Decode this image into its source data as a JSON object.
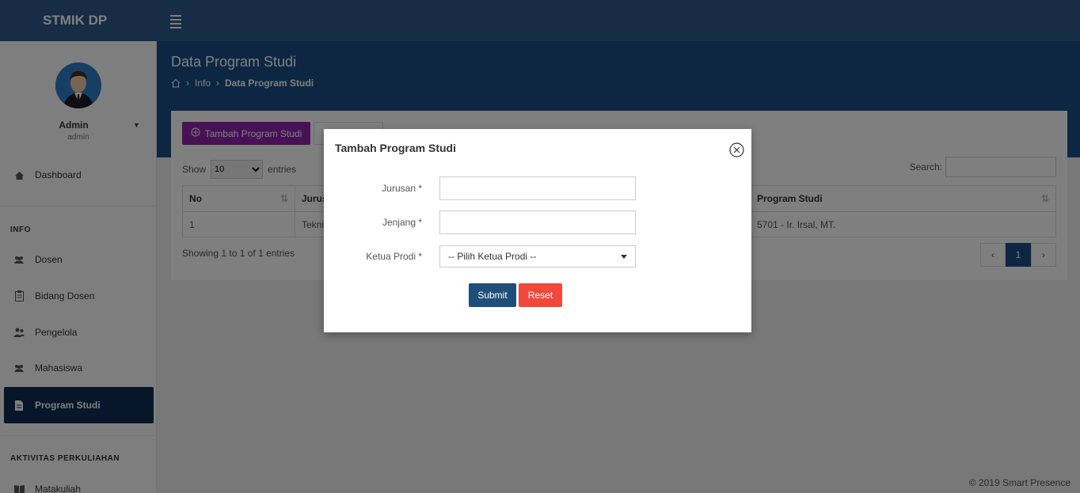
{
  "app": {
    "brand": "STMIK DP"
  },
  "user": {
    "name": "Admin",
    "role": "admin"
  },
  "sidebar": {
    "items": [
      {
        "label": "Dashboard",
        "icon": "home-icon"
      },
      {
        "label": "Dosen",
        "icon": "users-icon"
      },
      {
        "label": "Bidang Dosen",
        "icon": "clipboard-icon"
      },
      {
        "label": "Pengelola",
        "icon": "user-group-icon"
      },
      {
        "label": "Mahasiswa",
        "icon": "users-icon"
      },
      {
        "label": "Program Studi",
        "icon": "file-icon",
        "active": true
      },
      {
        "label": "Matakuliah",
        "icon": "book-icon"
      }
    ],
    "sections": {
      "info": "INFO",
      "aktivitas": "AKTIVITAS PERKULIAHAN"
    }
  },
  "header": {
    "title": "Data Program Studi",
    "breadcrumb": [
      "Info",
      "Data Program Studi"
    ]
  },
  "toolbar": {
    "add_label": "Tambah Program Studi"
  },
  "table": {
    "show_label": "Show",
    "entries_label": "entries",
    "page_size": "10",
    "search_label": "Search:",
    "columns": [
      "No",
      "Jurus",
      "Program Studi"
    ],
    "rows": [
      [
        "1",
        "Tekni",
        "5701 - Ir. Irsal, MT."
      ]
    ],
    "info": "Showing 1 to 1 of 1 entries",
    "pager": {
      "prev": "‹",
      "current": "1",
      "next": "›"
    }
  },
  "footer": {
    "text": "© 2019 Smart Presence"
  },
  "modal": {
    "title": "Tambah Program Studi",
    "fields": {
      "jurusan_label": "Jurusan *",
      "jenjang_label": "Jenjang *",
      "ketua_label": "Ketua Prodi *",
      "ketua_selected": "-- Pilih Ketua Prodi --"
    },
    "submit_label": "Submit",
    "reset_label": "Reset"
  },
  "colors": {
    "topbar": "#2c5b8a",
    "header": "#1a4e86",
    "active_nav": "#0f2d52",
    "add_button": "#8e24aa",
    "submit_button": "#1f4e7a",
    "reset_button": "#f1483c"
  }
}
